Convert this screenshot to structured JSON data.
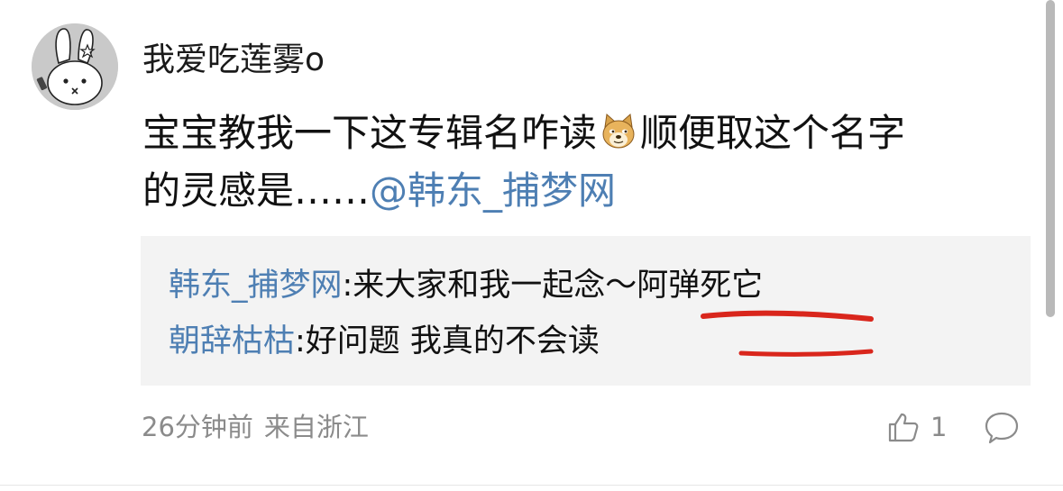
{
  "comment": {
    "username": "我爱吃莲雾o",
    "content_line1_before_emoji": "宝宝教我一下这专辑名咋读",
    "content_line1_after_emoji": "顺便取这个名字",
    "content_line2_text": "的灵感是……",
    "mention": "@韩东_捕梦网",
    "emoji_icon": "doge-emoji"
  },
  "replies": [
    {
      "author": "韩东_捕梦网",
      "text": ":来大家和我一起念～阿弹死它"
    },
    {
      "author": "朝辞枯枯",
      "text": ":好问题 我真的不会读"
    }
  ],
  "meta": {
    "time": "26分钟前",
    "location": "来自浙江"
  },
  "actions": {
    "like_count": "1",
    "like_icon": "thumbs-up-icon",
    "comment_icon": "comment-bubble-icon"
  },
  "colors": {
    "link": "#4e7fb3",
    "muted": "#8b8b8b",
    "reply_bg": "#f3f3f3",
    "annotation_red": "#d9261c"
  }
}
